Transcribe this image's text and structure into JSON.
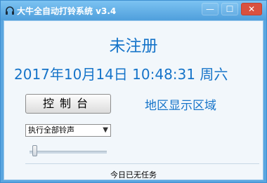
{
  "window": {
    "title": "大牛全自动打铃系统 v3.4",
    "minimize_glyph": "—",
    "maximize_glyph": "☐",
    "close_glyph": "✕"
  },
  "registration_status": "未注册",
  "clock_text": "2017年10月14日  10:48:31  周六",
  "control_button_label": "控制台",
  "region_display_label": "地区显示区域",
  "ring_mode_select": {
    "selected": "执行全部铃声"
  },
  "volume_slider": {
    "level": 0.05
  },
  "status_text": "今日已无任务",
  "colors": {
    "title_bar": "#5aa6e0",
    "accent_text": "#1674c9",
    "close_button": "#d9513f"
  },
  "icons": {
    "app_icon": "headphones-icon",
    "dropdown": "chevron-down-icon"
  }
}
